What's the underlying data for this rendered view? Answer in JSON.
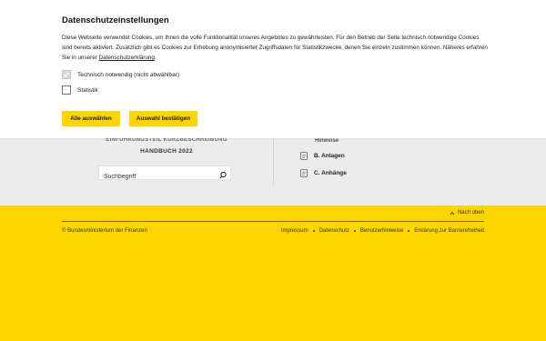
{
  "cookie_dialog": {
    "title": "Datenschutzeinstellungen",
    "intro_text": "Diese Webseite verwendet Cookies, um Ihnen die volle Funktionalität unseres Angebotes zu gewährleisten. Für den Betrieb der Seite technisch notwendige Cookies sind bereits aktiviert. Zusätzlich gibt es Cookies zur Erhebung anonymisierter Zugriffsdaten für Statistikzwecke, denen Sie einzeln zustimmen können. Näheres erfahren Sie in unserer",
    "privacy_link": "Datenschutzerklärung",
    "trailing_period": ".",
    "options": [
      {
        "label": "Technisch notwendig (nicht abwählbar)",
        "checked": true,
        "disabled": true
      },
      {
        "label": "Statistik",
        "checked": false,
        "disabled": false
      }
    ],
    "select_all_label": "Alle auswählen",
    "confirm_label": "Auswahl bestätigen"
  },
  "page": {
    "handbook_heading_cut": "EINFÜHRUNGSTEIL KURZBESCHREIBUNG",
    "handbook_subheading": "HANDBUCH 2022",
    "search": {
      "placeholder": "Suchbegriff"
    },
    "toc_cut_label": "Hinweise",
    "toc_items": [
      "B. Anlagen",
      "C. Anhänge"
    ]
  },
  "footer": {
    "back_to_top": "Nach oben",
    "copyright": "© Bundesministerium der Finanzen",
    "links": [
      "Impressum",
      "Datenschutz",
      "Benutzerhinweise",
      "Erklärung zur Barrierefreiheit"
    ]
  },
  "colors": {
    "accent_yellow": "#fdd600",
    "panel_gray": "#ececec"
  }
}
